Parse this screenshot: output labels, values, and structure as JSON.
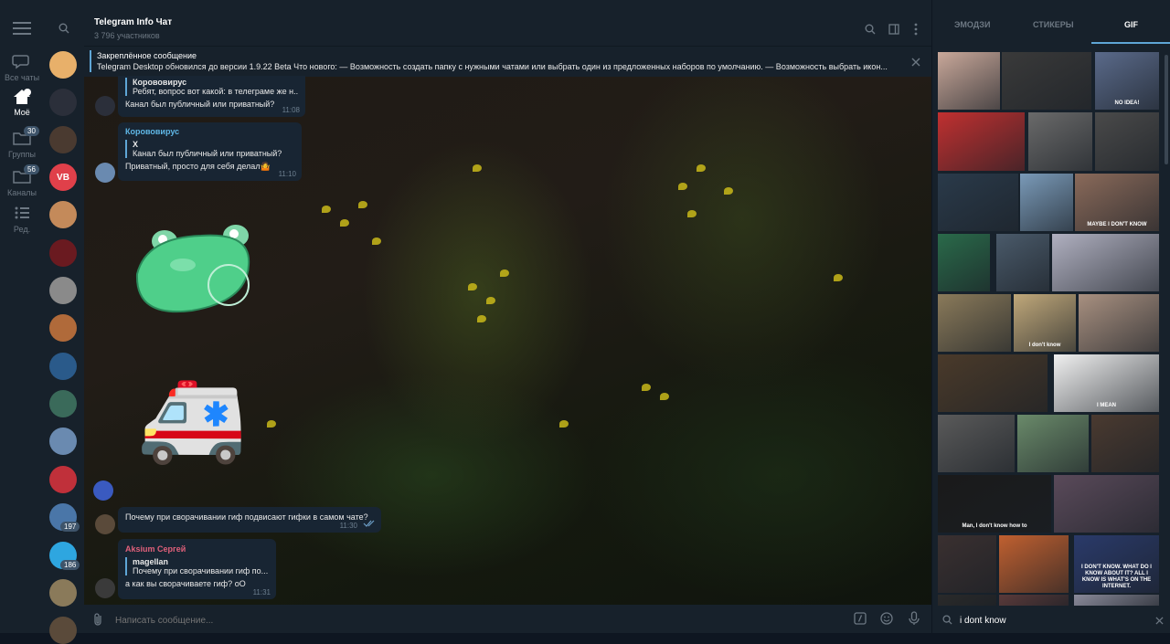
{
  "folders": {
    "items": [
      {
        "label": "Все чаты",
        "icon": "chat-bubble-icon"
      },
      {
        "label": "Моё",
        "icon": "home-icon"
      },
      {
        "label": "Группы",
        "icon": "folder-icon",
        "badge": "30"
      },
      {
        "label": "Каналы",
        "icon": "folder-icon",
        "badge": "56"
      },
      {
        "label": "Ред.",
        "icon": "edit-list-icon"
      }
    ]
  },
  "chatlist": {
    "avatars": [
      {
        "color": "#e8b06a"
      },
      {
        "color": "#2b2f3a"
      },
      {
        "color": "#4a3a30"
      },
      {
        "color": "#e0404a",
        "text": "VB"
      },
      {
        "color": "#c48a5a"
      },
      {
        "color": "#6a1a20"
      },
      {
        "color": "#8a8a8a"
      },
      {
        "color": "#b06a3a"
      },
      {
        "color": "#2a5a8a"
      },
      {
        "color": "#3a6a5a"
      },
      {
        "color": "#6a8ab0"
      },
      {
        "color": "#c0303a"
      },
      {
        "color": "#4a76a8",
        "badge": "197"
      },
      {
        "color": "#2ea6e0",
        "badge": "186"
      },
      {
        "color": "#8a7a5a"
      },
      {
        "color": "#5a4a3a"
      }
    ]
  },
  "header": {
    "title": "Telegram Info Чат",
    "subtitle": "3 796 участников"
  },
  "pinned": {
    "title": "Закреплённое сообщение",
    "text": "Telegram Desktop обновился до версии 1.9.22 Beta  Что нового: — Возможность создать папку с нужными чатами или выбрать один из предложенных наборов по умолчанию. — Возможность выбрать икон..."
  },
  "messages": [
    {
      "reply_name": "Корововирус",
      "reply_text": "Ребят, вопрос вот какой: в телеграме же н...",
      "text": "Канал был публичный или приватный?",
      "time": "11:08"
    },
    {
      "sender": "Корововирус",
      "reply_name": "X",
      "reply_text": "Канал был публичный или приватный?",
      "text": "Приватный, просто для себя делал🤷",
      "time": "11:10"
    },
    {
      "text": "Почему при сворачивании гиф подвисают гифки в самом чате?",
      "time": "11:30"
    },
    {
      "sender": "Aksium Сергей",
      "reply_name": "magellan",
      "reply_text": "Почему при сворачивании гиф по...",
      "text": "а как вы сворачиваете гиф? оО",
      "time": "11:31"
    }
  ],
  "sticker_ambulance": "🚑",
  "input": {
    "placeholder": "Написать сообщение..."
  },
  "panel": {
    "tabs": [
      "ЭМОДЗИ",
      "СТИКЕРЫ",
      "GIF"
    ],
    "active_tab": "GIF",
    "search_value": "i dont know",
    "gif_captions": [
      "NO IDEA!",
      "MAYBE I DON'T KNOW",
      "I don't know",
      "I MEAN",
      "Man, I don't know how to",
      "I DON'T KNOW. WHAT DO I KNOW ABOUT IT? ALL I KNOW IS WHAT'S ON THE INTERNET."
    ]
  },
  "colors": {
    "accent": "#5fa6d6",
    "sender_red": "#e0607a",
    "sender_blue": "#5fb7e6"
  }
}
